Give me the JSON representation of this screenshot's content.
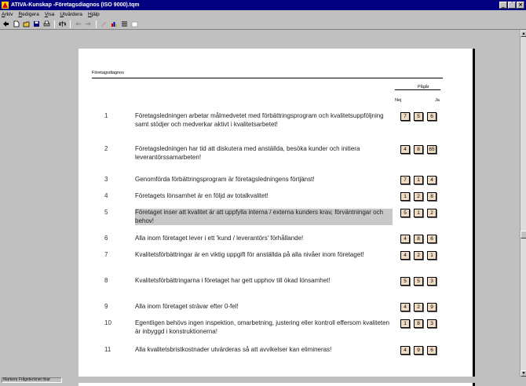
{
  "window": {
    "title": "ATIVA-Kunskap -Företagsdiagnos (ISO 9000).tqm",
    "controls": [
      "_",
      "´",
      "×"
    ]
  },
  "menu": [
    "Arkiv",
    "Redigera",
    "Visa",
    "Utvärdera",
    "Hjälp"
  ],
  "toolbar_icons": [
    "back-icon",
    "new-icon",
    "open-icon",
    "save-icon",
    "print-icon",
    "scale-icon",
    "arrow-left-icon",
    "arrow-right-icon",
    "edit-icon",
    "chart-icon",
    "list-icon",
    "window-icon"
  ],
  "document": {
    "heading": "Företagsdiagnos",
    "column_group": "Pågår",
    "col_left": "Nej",
    "col_right": "Ja",
    "items": [
      {
        "num": "1",
        "text": "Företagsledningen arbetar målmedvetet med förbättringsprogram och kvalitetsuppföljning samt stödjer och medverkar aktivt i kvalitetsarbetet!",
        "values": [
          "7",
          "5",
          "6"
        ]
      },
      {
        "num": "2",
        "text": " Företagsledningen har tid att diskutera med anställda, besöka kunder och initiera leverantörssamarbeten!",
        "values": [
          "4",
          "8",
          "65"
        ]
      },
      {
        "num": "3",
        "text": "Genomförda förbättringsprogram är företagsledningens förtjänst!",
        "values": [
          "7",
          "1",
          "4"
        ]
      },
      {
        "num": "4",
        "text": " Företagets lönsamhet är en följd av totalkvalitet!",
        "values": [
          "1",
          "2",
          "8"
        ]
      },
      {
        "num": "5",
        "text": "Företaget inser att kvalitet är att uppfylla interna / externa kunders krav, förväntningar och behov!",
        "values": [
          "5",
          "1",
          "2"
        ]
      },
      {
        "num": "6",
        "text": "Alla inom företaget lever i ett 'kund / leverantörs' förhållande!",
        "values": [
          "4",
          "8",
          "6"
        ]
      },
      {
        "num": "7",
        "text": "Kvalitetsförbättringar är en viktig uppgift för anställda på alla nivåer inom företaget!",
        "values": [
          "4",
          "2",
          "1"
        ]
      },
      {
        "num": "8",
        "text": "Kvalitetsförbättringarna i företaget har gett upphov till ökad lönsamhet!",
        "values": [
          "5",
          "5",
          "3"
        ]
      },
      {
        "num": "9",
        "text": "Alla inom företaget strävar efter 0-fel!",
        "values": [
          "4",
          "2",
          "9"
        ]
      },
      {
        "num": "10",
        "text": "Egentligen behövs ingen inspektion, omarbetning, justering eller kontroll effersom kvaliteten är inbyggd i konstruktionerna!",
        "values": [
          "1",
          "8",
          "3"
        ]
      },
      {
        "num": "11",
        "text": "Alla kvalitetsbristkostnader utvärderas så att avvikelser kan elimineras!",
        "values": [
          "4",
          "9",
          "6"
        ]
      }
    ]
  },
  "status": "Markera Frågetecknet  ökar"
}
